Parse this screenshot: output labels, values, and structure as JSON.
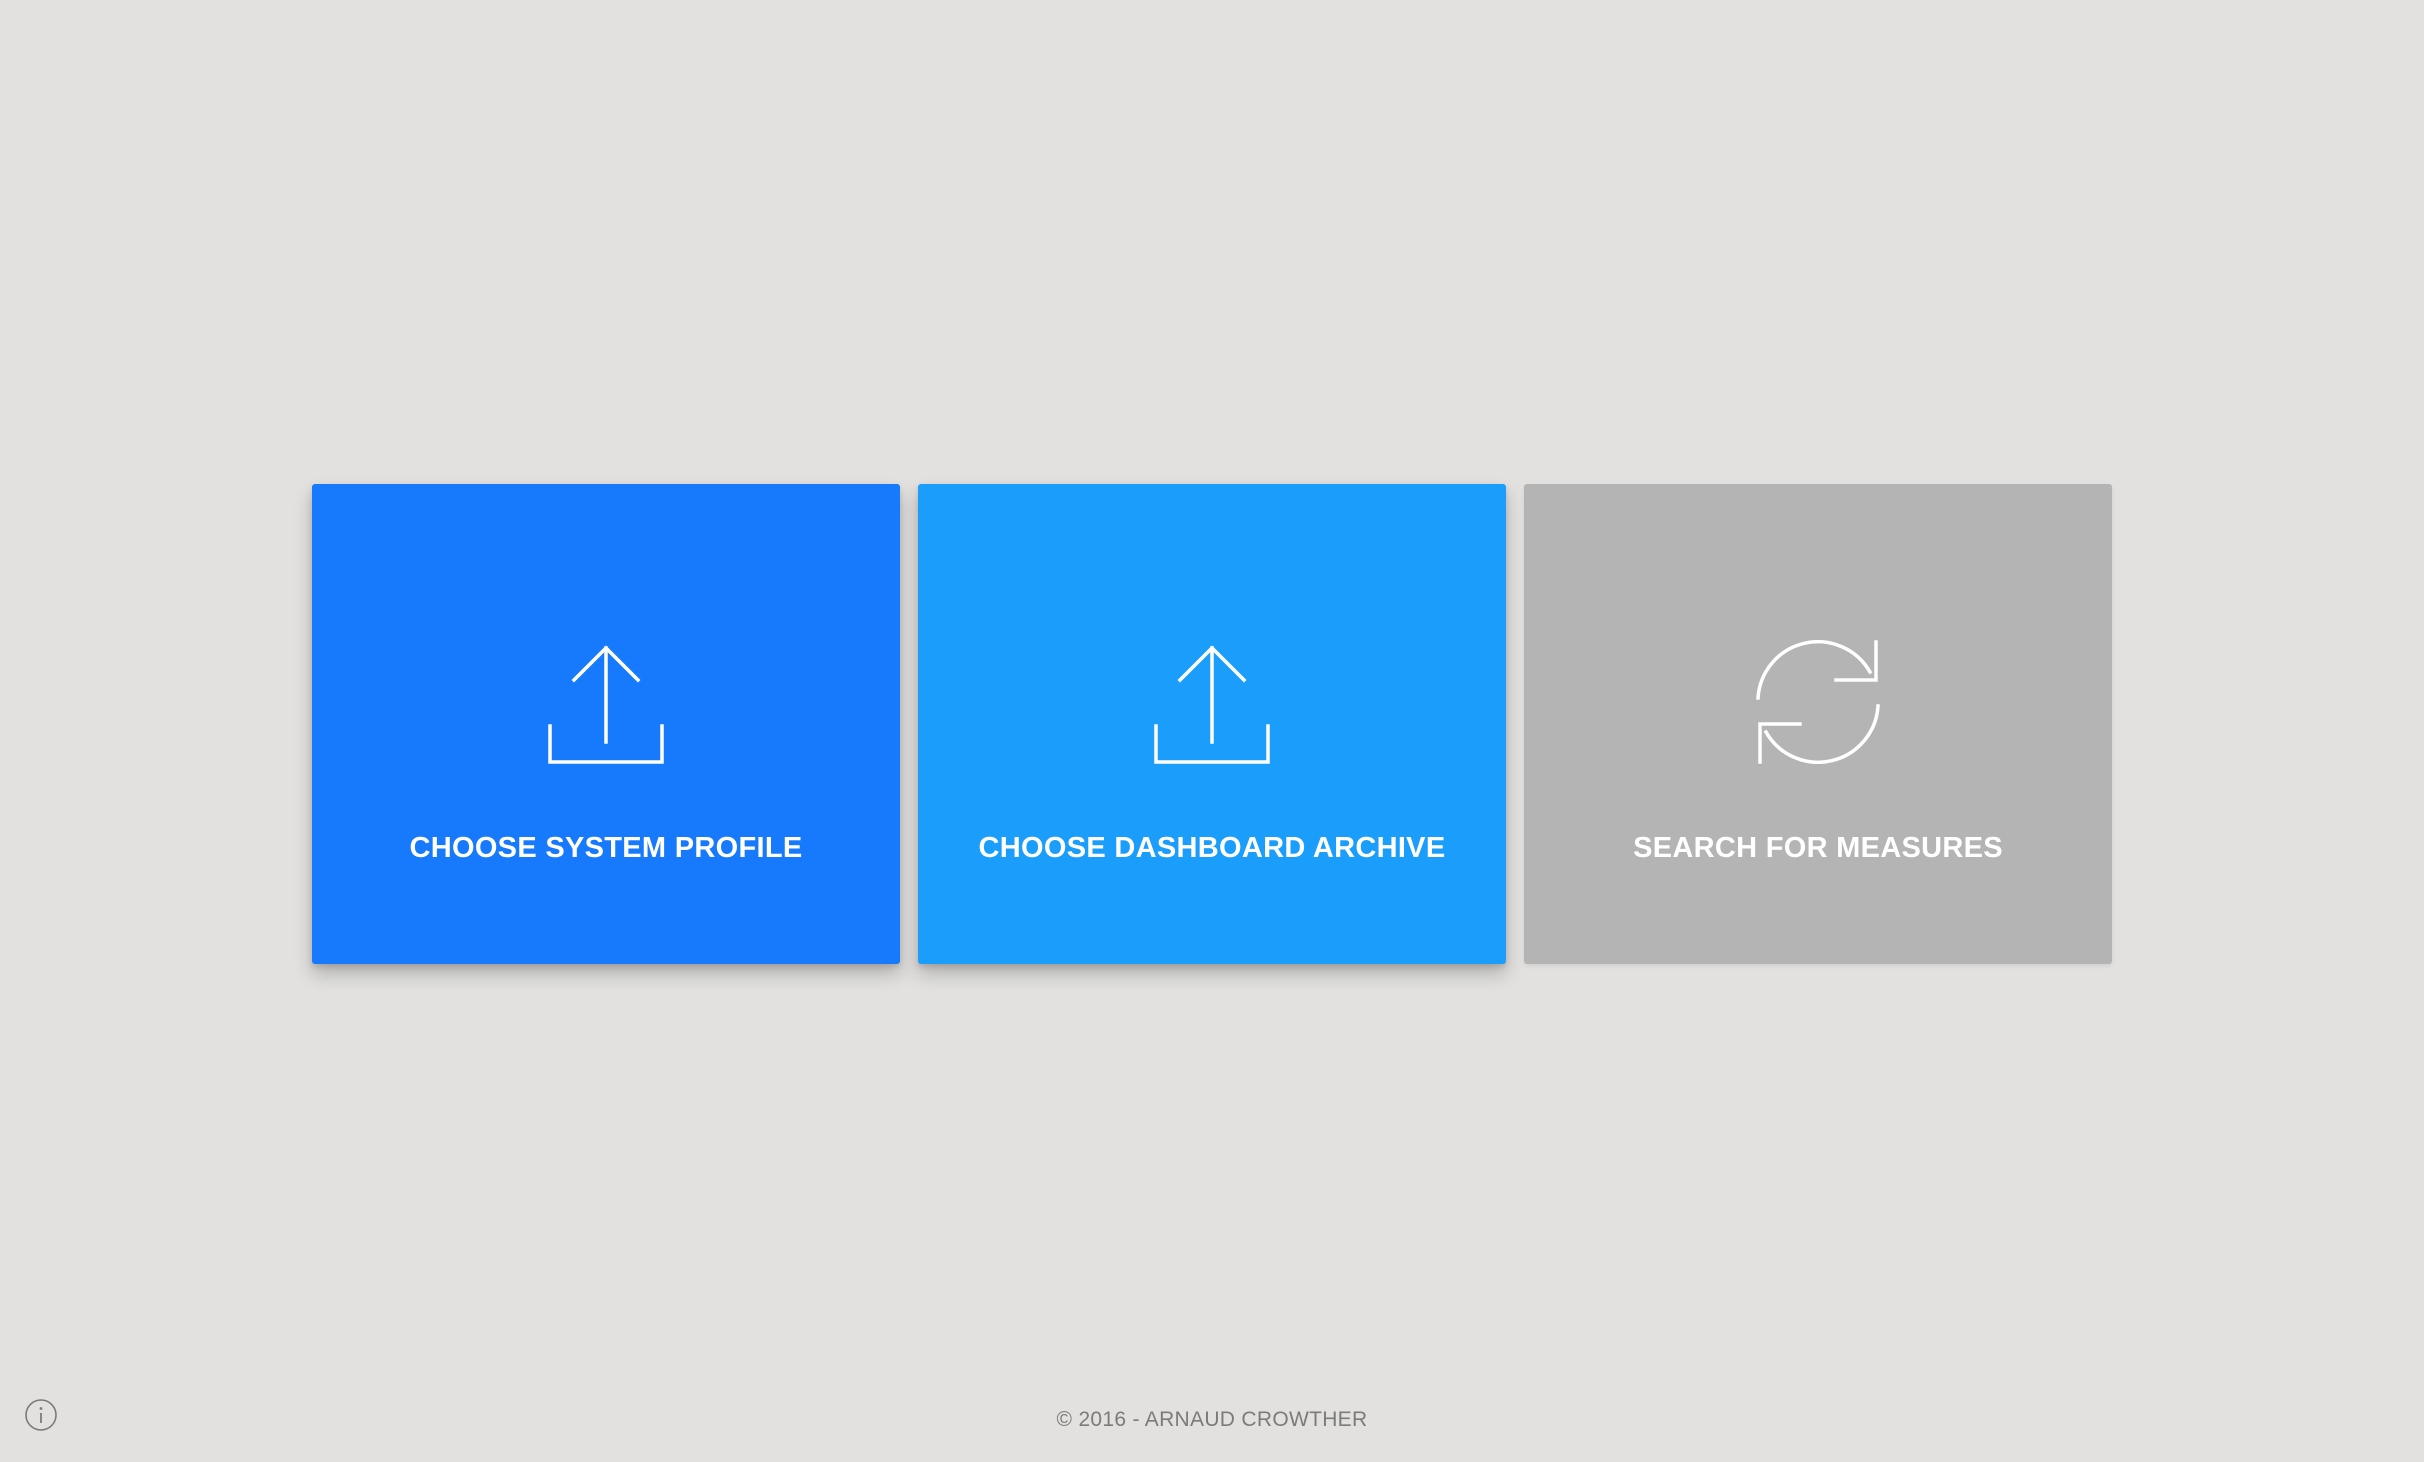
{
  "cards": [
    {
      "label": "CHOOSE SYSTEM PROFILE",
      "icon": "upload-icon",
      "color": "#1779fb"
    },
    {
      "label": "CHOOSE DASHBOARD ARCHIVE",
      "icon": "upload-icon",
      "color": "#1b9efb"
    },
    {
      "label": "SEARCH FOR MEASURES",
      "icon": "refresh-icon",
      "color": "#b4b4b4"
    }
  ],
  "footer": {
    "text": "© 2016 - ARNAUD CROWTHER"
  },
  "info": {
    "icon": "info-icon"
  },
  "colors": {
    "background": "#e2e1df",
    "footer_text": "#7b7b7b"
  }
}
